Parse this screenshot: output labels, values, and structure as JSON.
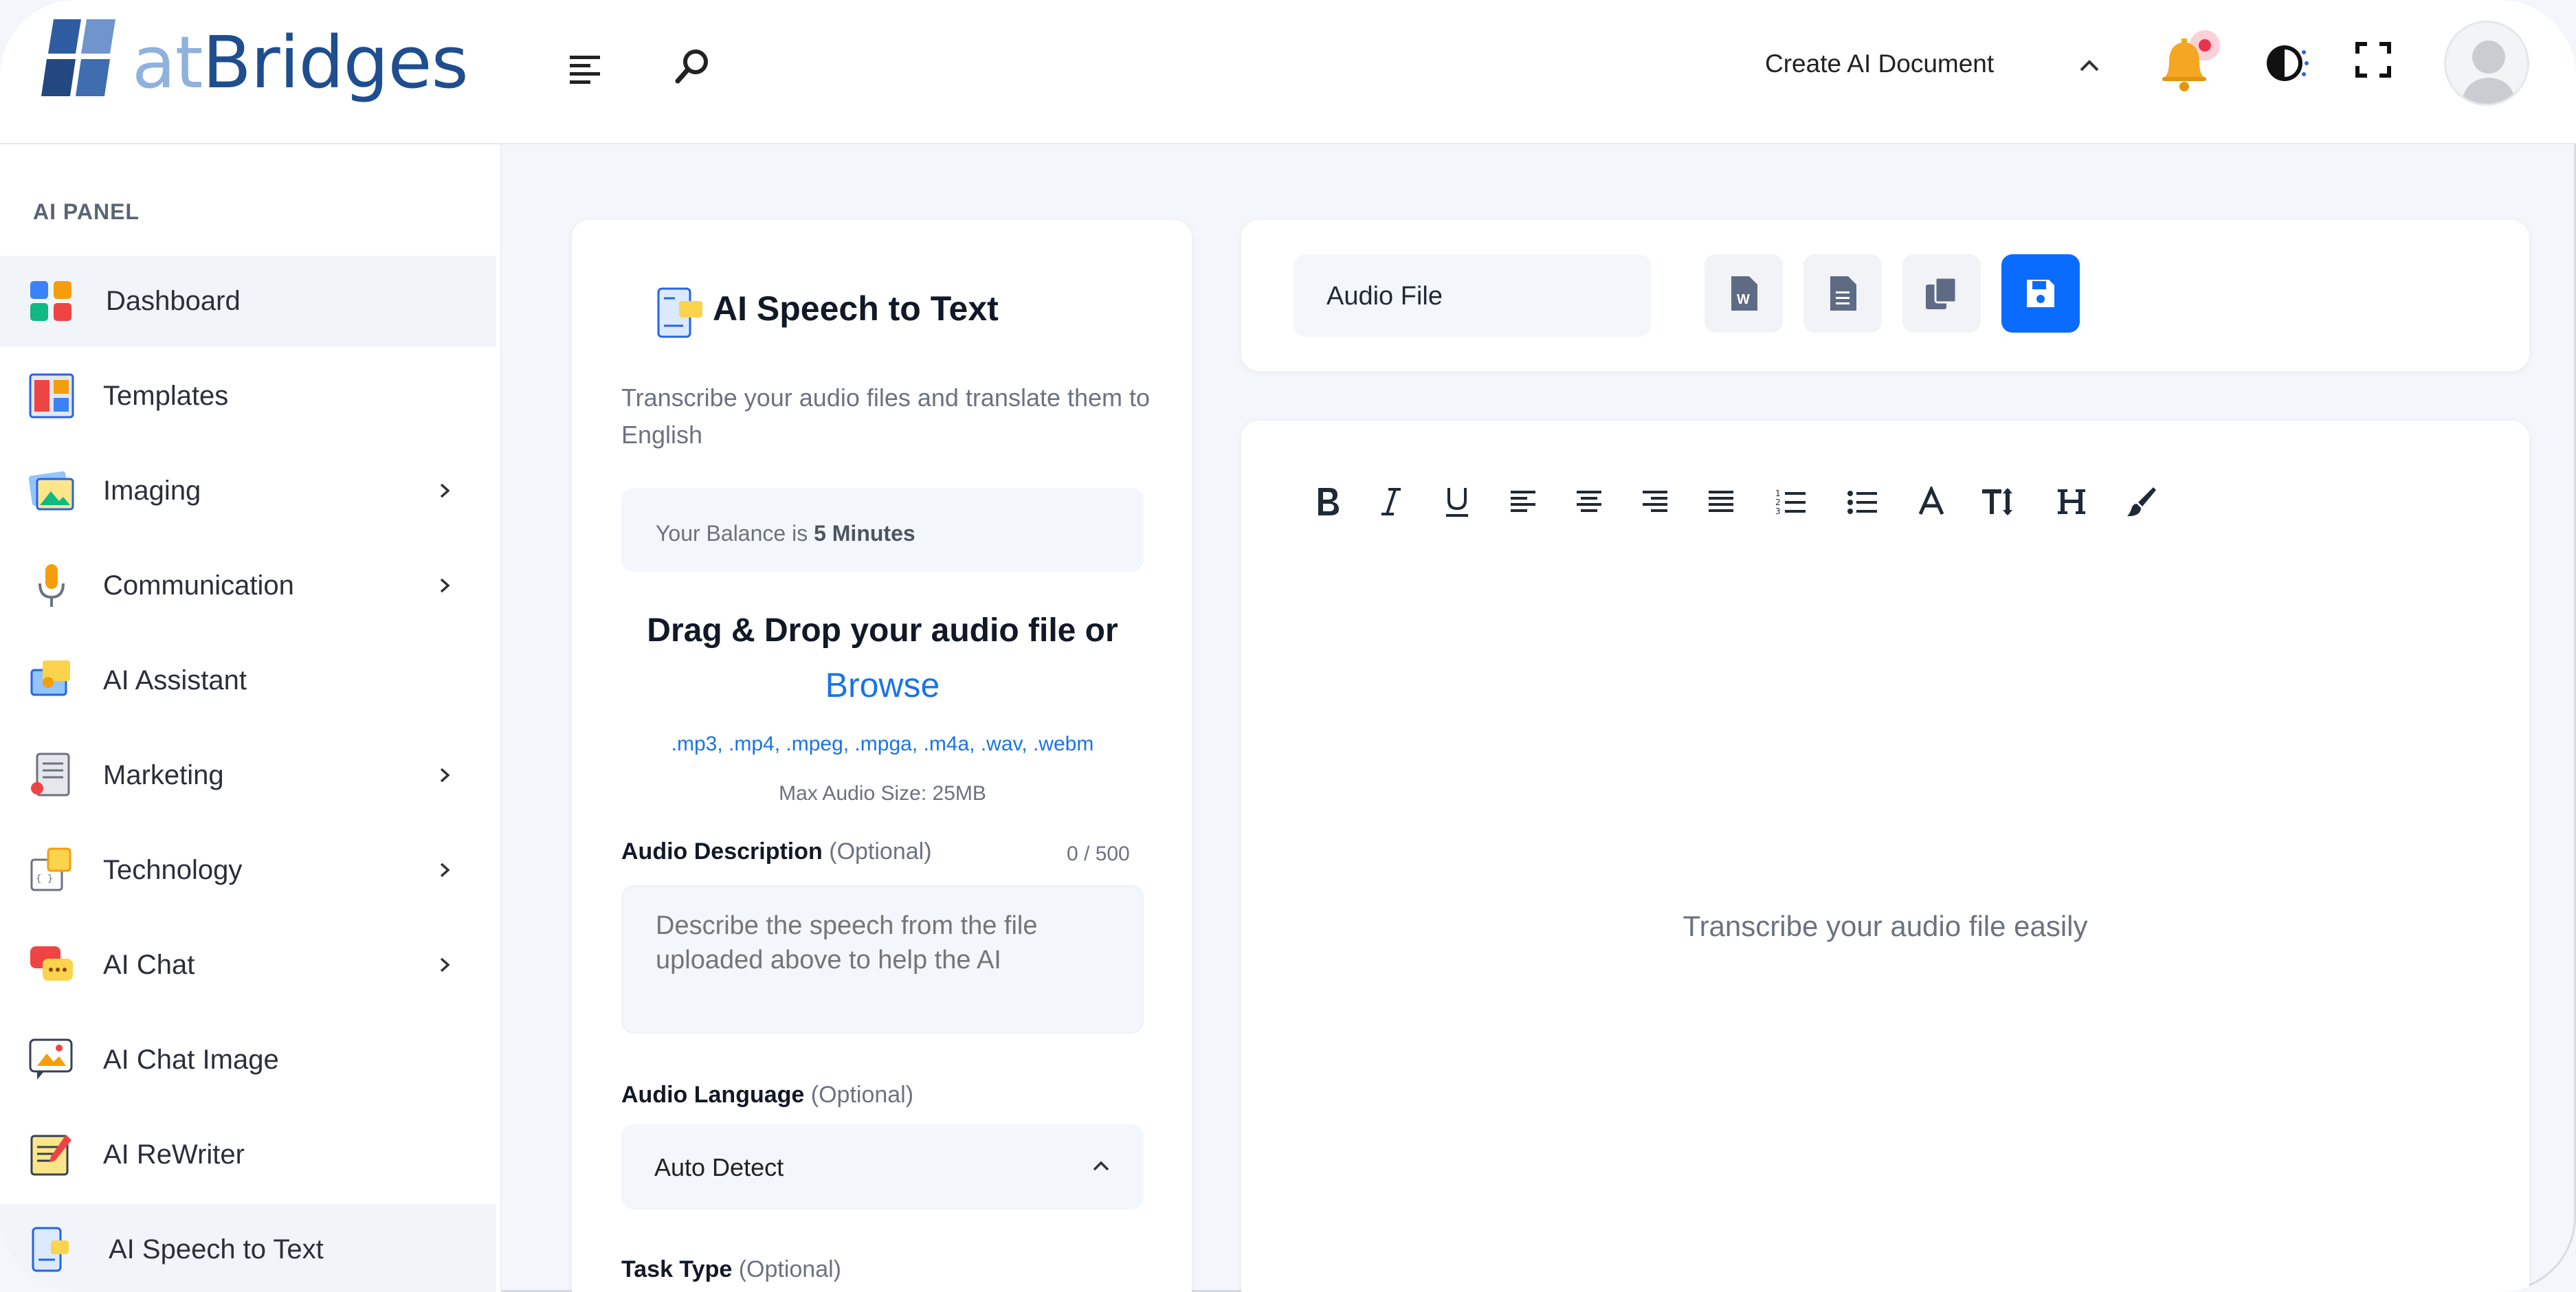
{
  "header": {
    "logo_part1": "at",
    "logo_part2": "Bridges",
    "create_doc_label": "Create AI Document"
  },
  "sidebar": {
    "panel_title": "AI PANEL",
    "items": [
      {
        "label": "Dashboard",
        "icon": "dashboard-icon",
        "chevron": false,
        "active": true
      },
      {
        "label": "Templates",
        "icon": "templates-icon",
        "chevron": false
      },
      {
        "label": "Imaging",
        "icon": "imaging-icon",
        "chevron": true
      },
      {
        "label": "Communication",
        "icon": "microphone-icon",
        "chevron": true
      },
      {
        "label": "AI Assistant",
        "icon": "assistant-icon",
        "chevron": false
      },
      {
        "label": "Marketing",
        "icon": "marketing-icon",
        "chevron": true
      },
      {
        "label": "Technology",
        "icon": "technology-icon",
        "chevron": true
      },
      {
        "label": "AI Chat",
        "icon": "chat-icon",
        "chevron": true
      },
      {
        "label": "AI Chat Image",
        "icon": "chat-image-icon",
        "chevron": false
      },
      {
        "label": "AI ReWriter",
        "icon": "rewriter-icon",
        "chevron": false
      },
      {
        "label": "AI Speech to Text",
        "icon": "speech-to-text-icon",
        "chevron": false,
        "active": true
      }
    ]
  },
  "tool": {
    "title": "AI Speech to Text",
    "subtitle": "Transcribe your audio files and translate them to English",
    "balance_prefix": "Your Balance is",
    "balance_value": "5 Minutes",
    "drop_title": "Drag & Drop your audio file or",
    "browse_label": "Browse",
    "extensions": ".mp3, .mp4, .mpeg, .mpga, .m4a, .wav, .webm",
    "max_size": "Max Audio Size: 25MB",
    "description_label": "Audio Description",
    "optional": "(Optional)",
    "description_counter": "0 / 500",
    "description_placeholder": "Describe the speech from the file uploaded above to help the AI",
    "language_label": "Audio Language",
    "language_value": "Auto Detect",
    "task_label": "Task Type"
  },
  "document": {
    "file_name": "Audio File",
    "actions": [
      "word-document-icon",
      "text-document-icon",
      "copy-icon",
      "save-icon"
    ],
    "editor_placeholder": "Transcribe your audio file easily",
    "toolbar": [
      "bold-icon",
      "italic-icon",
      "underline-icon",
      "align-left-icon",
      "align-center-icon",
      "align-right-icon",
      "align-justify-icon",
      "ordered-list-icon",
      "unordered-list-icon",
      "font-color-icon",
      "text-size-icon",
      "heading-icon",
      "paint-brush-icon"
    ]
  },
  "colors": {
    "accent": "#0a6cff",
    "link": "#1a73e8",
    "bell": "#f5a623",
    "notification_dot": "#e8344d"
  }
}
